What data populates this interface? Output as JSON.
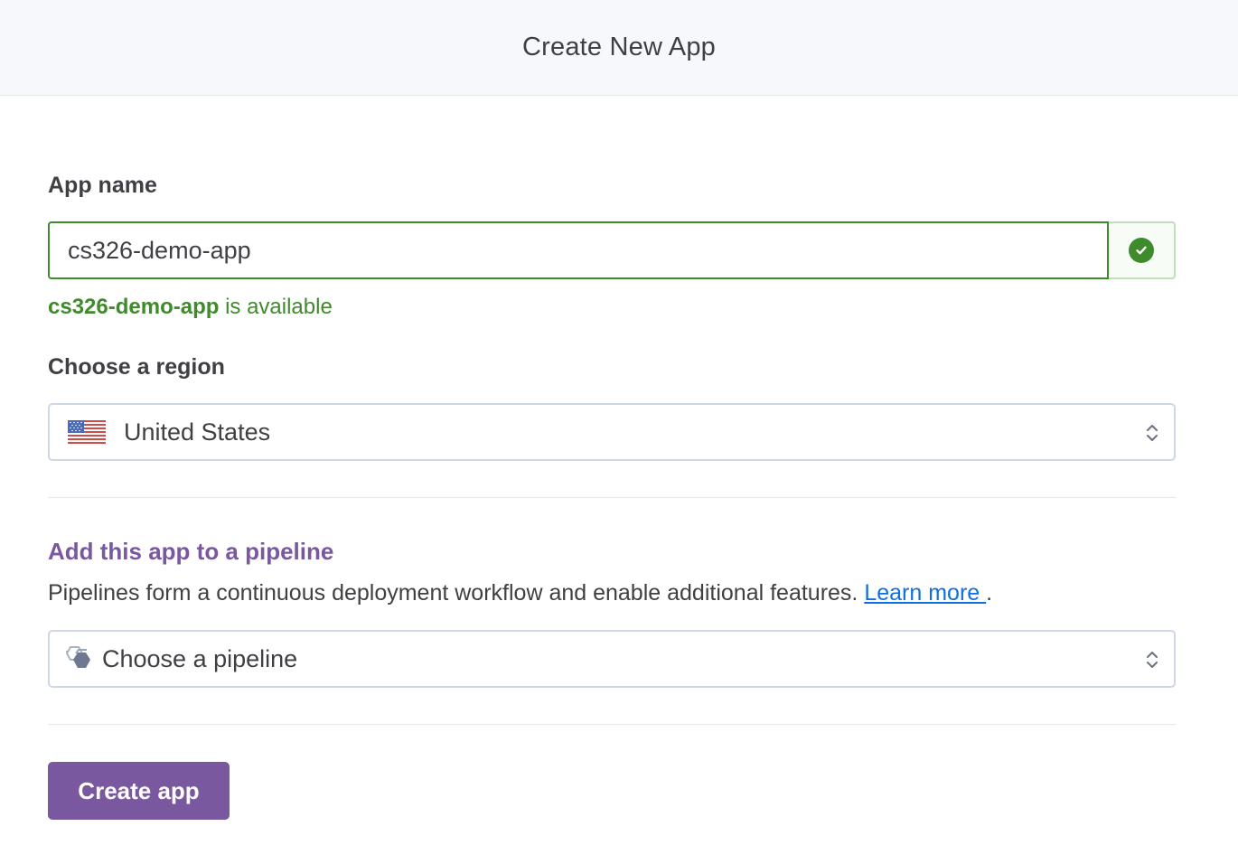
{
  "header": {
    "title": "Create New App"
  },
  "app_name": {
    "label": "App name",
    "value": "cs326-demo-app",
    "status_icon": "check-circle-icon",
    "availability_name": "cs326-demo-app",
    "availability_suffix": " is available"
  },
  "region": {
    "label": "Choose a region",
    "selected": "United States",
    "flag_icon": "us-flag-icon"
  },
  "pipeline": {
    "heading": "Add this app to a pipeline",
    "description": "Pipelines form a continuous deployment workflow and enable additional features. ",
    "learn_more": "Learn more ",
    "period": ".",
    "placeholder": "Choose a pipeline",
    "icon": "pipeline-icon"
  },
  "actions": {
    "create_label": "Create app"
  },
  "colors": {
    "accent_purple": "#79589f",
    "success_green": "#3f8a2b",
    "link_blue": "#0e6fe0",
    "text_dark": "#3f3f44"
  }
}
